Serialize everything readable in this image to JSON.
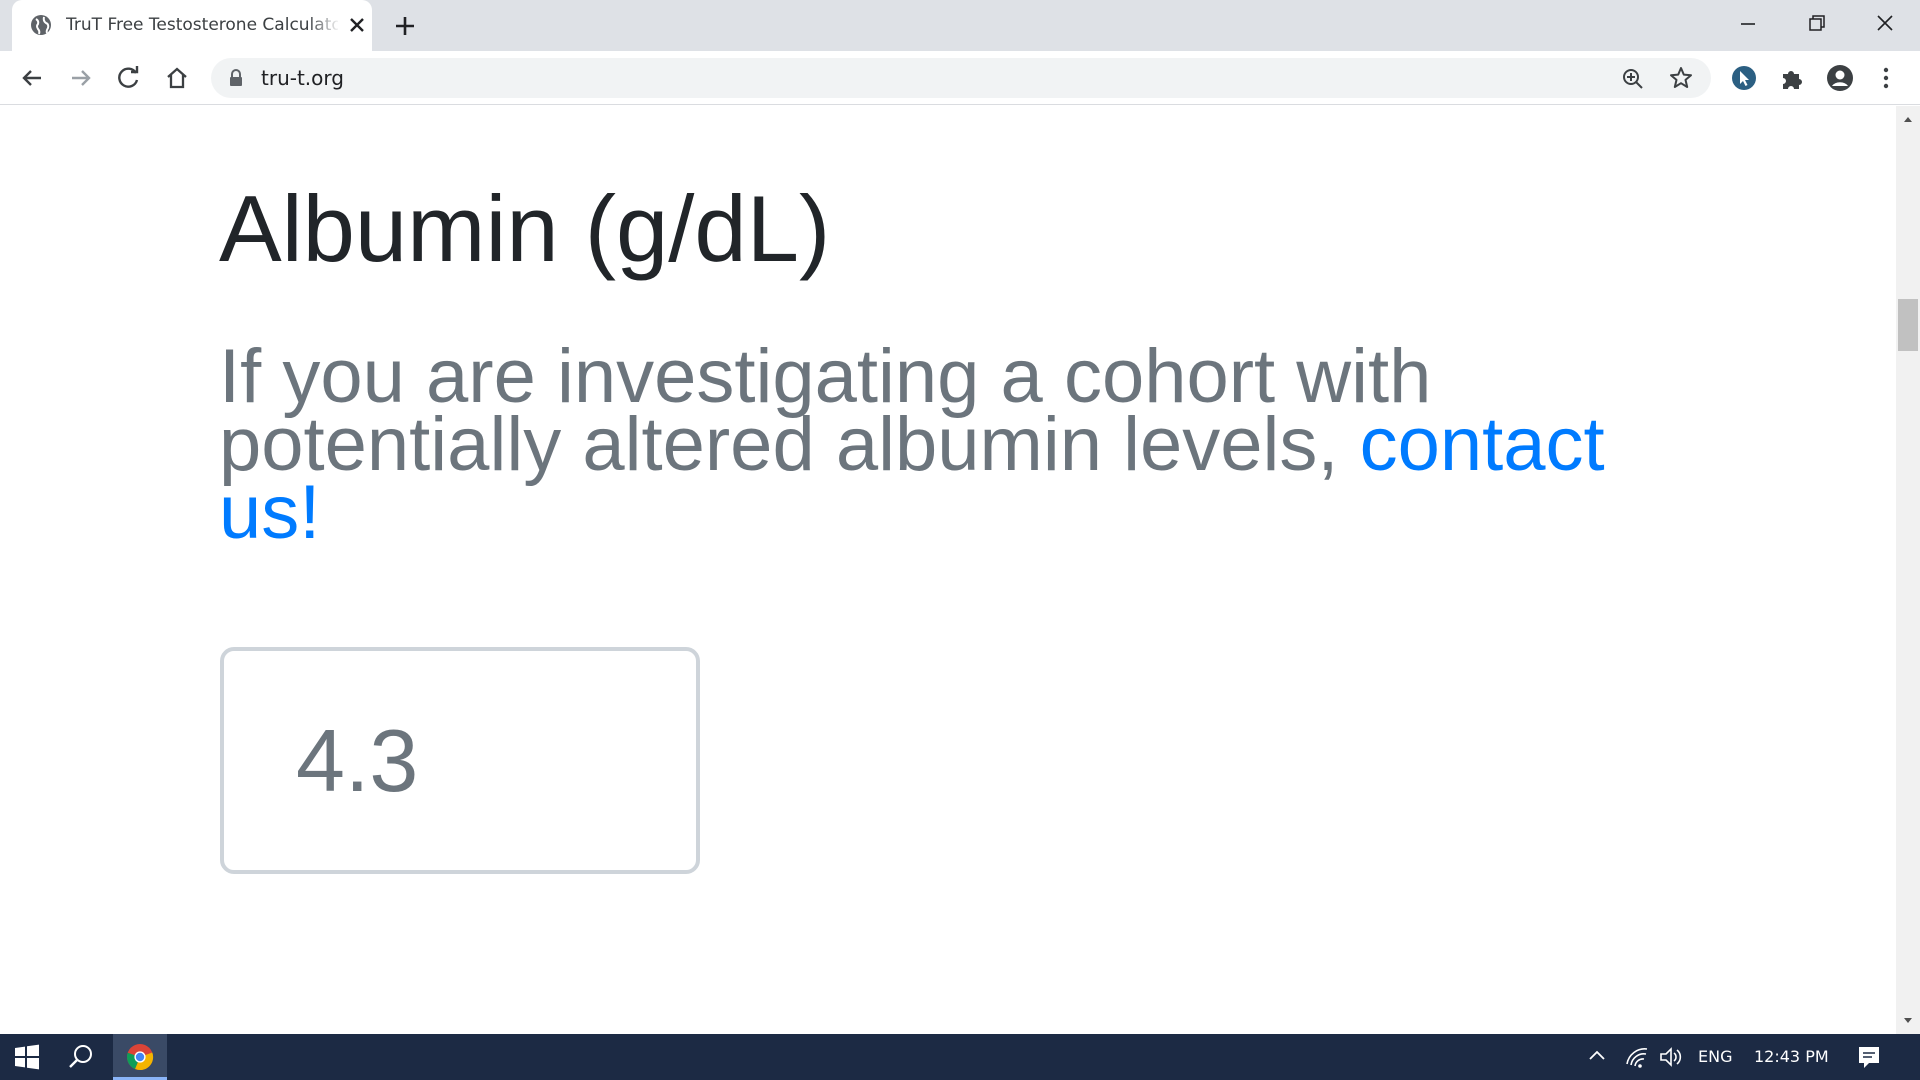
{
  "browser": {
    "tab": {
      "title": "TruT Free Testosterone Calculator",
      "favicon": "globe-icon",
      "close_icon": "close-icon"
    },
    "new_tab_icon": "plus-icon",
    "window_controls": [
      "minimize-icon",
      "restore-icon",
      "close-icon"
    ],
    "toolbar": {
      "back_icon": "back-arrow-icon",
      "forward_icon": "forward-arrow-icon",
      "reload_icon": "reload-icon",
      "home_icon": "home-icon",
      "lock_icon": "lock-icon",
      "url": "tru-t.org",
      "zoom_icon": "zoom-icon",
      "bookmark_icon": "star-icon",
      "extensions": [
        "cursor-extension-icon",
        "puzzle-icon",
        "account-icon",
        "kebab-menu-icon"
      ]
    }
  },
  "page": {
    "heading": "Albumin (g/dL)",
    "description": "If you are investigating a cohort with potentially altered albumin levels, ",
    "contact_link": "contact us!",
    "albumin_input": {
      "value": "4.3"
    }
  },
  "taskbar": {
    "start_icon": "windows-start-icon",
    "search_icon": "search-icon",
    "pinned_app": "chrome-icon",
    "tray": {
      "chevron_icon": "chevron-up-icon",
      "network_icon": "wifi-icon",
      "volume_icon": "speaker-icon",
      "language": "ENG",
      "time": "12:43 PM",
      "notifications_icon": "notification-icon"
    }
  },
  "colors": {
    "tabstrip_bg": "#dee1e6",
    "heading": "#212529",
    "muted_text": "#6c757d",
    "link": "#007bff",
    "input_border": "#ced4da",
    "taskbar_bg": "#1c2a44"
  }
}
